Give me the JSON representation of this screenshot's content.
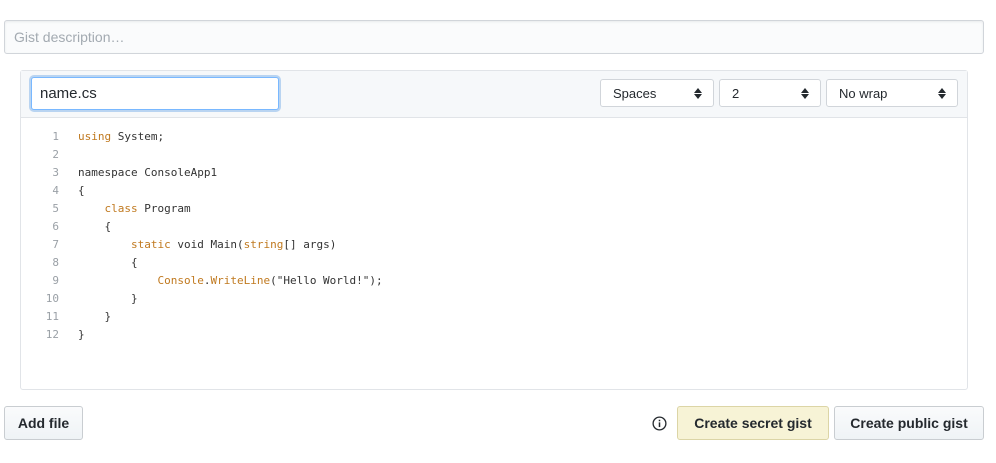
{
  "description": {
    "placeholder": "Gist description…",
    "value": ""
  },
  "file": {
    "filename": "name.cs",
    "indent_mode": "Spaces",
    "indent_size": "2",
    "wrap_mode": "No wrap",
    "code_lines": [
      {
        "num": "1",
        "tokens": [
          {
            "t": "using",
            "k": "kw"
          },
          {
            "t": " System;"
          }
        ]
      },
      {
        "num": "2",
        "tokens": []
      },
      {
        "num": "3",
        "tokens": [
          {
            "t": "namespace ConsoleApp1"
          }
        ]
      },
      {
        "num": "4",
        "tokens": [
          {
            "t": "{"
          }
        ]
      },
      {
        "num": "5",
        "tokens": [
          {
            "t": "    "
          },
          {
            "t": "class",
            "k": "kw"
          },
          {
            "t": " Program"
          }
        ]
      },
      {
        "num": "6",
        "tokens": [
          {
            "t": "    {"
          }
        ]
      },
      {
        "num": "7",
        "tokens": [
          {
            "t": "        "
          },
          {
            "t": "static",
            "k": "kw"
          },
          {
            "t": " void Main("
          },
          {
            "t": "string",
            "k": "kw"
          },
          {
            "t": "[] args)"
          }
        ]
      },
      {
        "num": "8",
        "tokens": [
          {
            "t": "        {"
          }
        ]
      },
      {
        "num": "9",
        "tokens": [
          {
            "t": "            "
          },
          {
            "t": "Console",
            "k": "kw"
          },
          {
            "t": "."
          },
          {
            "t": "WriteLine",
            "k": "kw"
          },
          {
            "t": "(\"Hello World!\");"
          }
        ]
      },
      {
        "num": "10",
        "tokens": [
          {
            "t": "        }"
          }
        ]
      },
      {
        "num": "11",
        "tokens": [
          {
            "t": "    }"
          }
        ]
      },
      {
        "num": "12",
        "tokens": [
          {
            "t": "}"
          }
        ]
      }
    ]
  },
  "actions": {
    "add_file": "Add file",
    "create_secret": "Create secret gist",
    "create_public": "Create public gist",
    "info_icon": "info-icon"
  },
  "colors": {
    "keyword": "#c0791f",
    "secret_button_bg": "#f7f3d6",
    "focus_ring": "#79b8ff"
  }
}
